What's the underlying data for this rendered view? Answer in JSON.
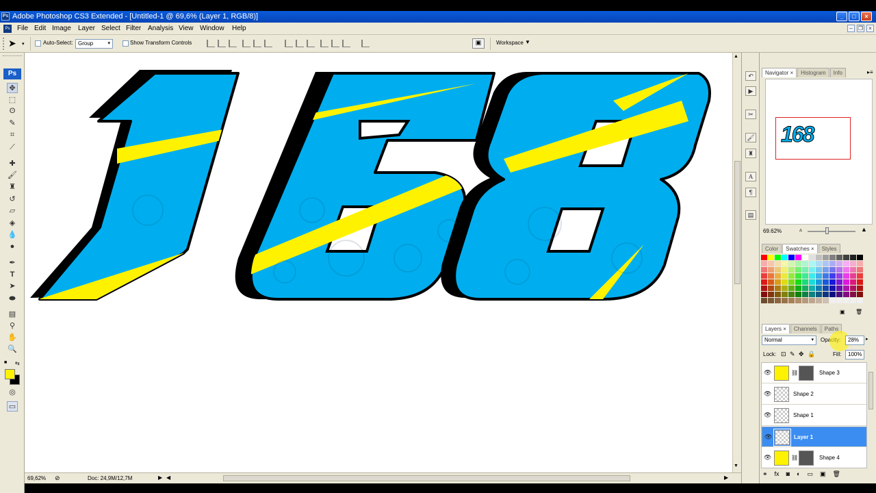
{
  "window": {
    "title": "Adobe Photoshop CS3 Extended - [Untitled-1 @ 69,6% (Layer 1, RGB/8)]",
    "app_icon_label": "Ps"
  },
  "menu": [
    "File",
    "Edit",
    "Image",
    "Layer",
    "Select",
    "Filter",
    "Analysis",
    "View",
    "Window",
    "Help"
  ],
  "options": {
    "auto_select_label": "Auto-Select:",
    "auto_select_value": "Group",
    "transform_label": "Show Transform Controls",
    "workspace_label": "Workspace"
  },
  "toolbox": {
    "logo": "Ps"
  },
  "artwork": {
    "text": "168",
    "colors": {
      "fill": "#00aeef",
      "stripe": "#fff200",
      "outline": "#000000"
    }
  },
  "status": {
    "zoom": "69,62%",
    "doc": "Doc: 24,9M/12,7M"
  },
  "navigator": {
    "tabs": [
      "Navigator",
      "Histogram",
      "Info"
    ],
    "zoom": "69.62%",
    "thumb_text": "168"
  },
  "swatches": {
    "tabs": [
      "Color",
      "Swatches",
      "Styles"
    ]
  },
  "layers_panel": {
    "tabs": [
      "Layers",
      "Channels",
      "Paths"
    ],
    "blend_mode": "Normal",
    "opacity_label": "Opacity:",
    "opacity_value": "28%",
    "lock_label": "Lock:",
    "fill_label": "Fill:",
    "fill_value": "100%",
    "layers": [
      {
        "name": "Shape 3",
        "thumb": "yellow",
        "mask": true,
        "selected": false
      },
      {
        "name": "Shape 2",
        "thumb": "checker",
        "mask": false,
        "selected": false
      },
      {
        "name": "Shape 1",
        "thumb": "checker",
        "mask": false,
        "selected": false
      },
      {
        "name": "Layer 1",
        "thumb": "checker",
        "mask": false,
        "selected": true
      },
      {
        "name": "Shape 4",
        "thumb": "yellow",
        "mask": true,
        "selected": false
      }
    ]
  }
}
